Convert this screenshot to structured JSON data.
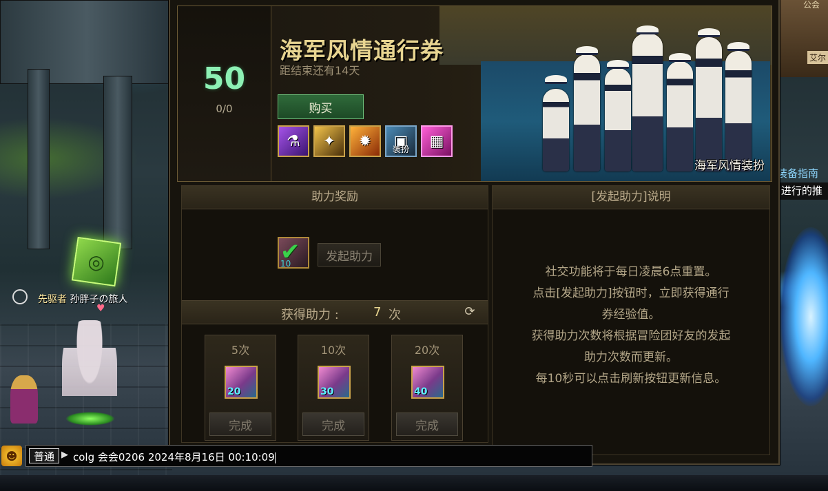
{
  "world": {
    "character_prefix": "先驱者",
    "character_name": "孙胖子の旅人",
    "right_top_fragment": "公会",
    "right_fragment": "艾尔",
    "right_guide_line1": "装备指南",
    "right_guide_line2": "]进行的推"
  },
  "pass": {
    "level": "50",
    "progress": "0/0",
    "title": "海军风情通行券",
    "subtitle": "距结束还有14天",
    "buy_label": "购买",
    "reward_icons": [
      {
        "name": "potion-icon",
        "glyph": "⚗",
        "tag": ""
      },
      {
        "name": "scroll-icon",
        "glyph": "✦",
        "tag": ""
      },
      {
        "name": "flame-box-icon",
        "glyph": "✹",
        "tag": ""
      },
      {
        "name": "outfit-box-icon",
        "glyph": "▣",
        "tag": "装扮"
      },
      {
        "name": "costume-icon",
        "glyph": "▦",
        "tag": ""
      }
    ],
    "outfit_label": "海军风情装扮"
  },
  "assist": {
    "header": "助力奖励",
    "icon_count": "10",
    "start_button": "发起助力",
    "count_label": "获得助力 :",
    "count_value": "7",
    "count_unit": "次",
    "tiers": [
      {
        "label": "5次",
        "reward_num": "20",
        "button": "完成"
      },
      {
        "label": "10次",
        "reward_num": "30",
        "button": "完成"
      },
      {
        "label": "20次",
        "reward_num": "40",
        "button": "完成"
      }
    ]
  },
  "explain": {
    "header": "[发起助力]说明",
    "lines": [
      "社交功能将于每日凌晨6点重置。",
      "点击[发起助力]按钮时，立即获得通行",
      "券经验值。",
      "获得助力次数将根据冒险团好友的发起",
      "助力次数而更新。",
      "每10秒可以点击刷新按钮更新信息。"
    ]
  },
  "chat": {
    "mode": "普通",
    "arrow": "▶",
    "text": "colg 会会0206 2024年8月16日 00:10:09"
  }
}
